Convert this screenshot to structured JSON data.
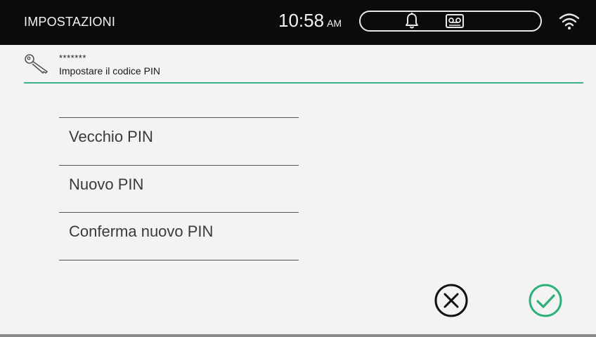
{
  "statusbar": {
    "title": "IMPOSTAZIONI",
    "time": "10:58",
    "ampm": "AM"
  },
  "header": {
    "icon": "key-icon",
    "masked_value": "*******",
    "subtitle": "Impostare il codice PIN",
    "accent_color": "#3db08a"
  },
  "fields": [
    {
      "label": "Vecchio PIN"
    },
    {
      "label": "Nuovo PIN"
    },
    {
      "label": "Conferma nuovo PIN"
    }
  ],
  "actions": {
    "cancel_icon": "cancel-x-circle-icon",
    "confirm_icon": "confirm-check-circle-icon",
    "confirm_color": "#2fb07a"
  }
}
